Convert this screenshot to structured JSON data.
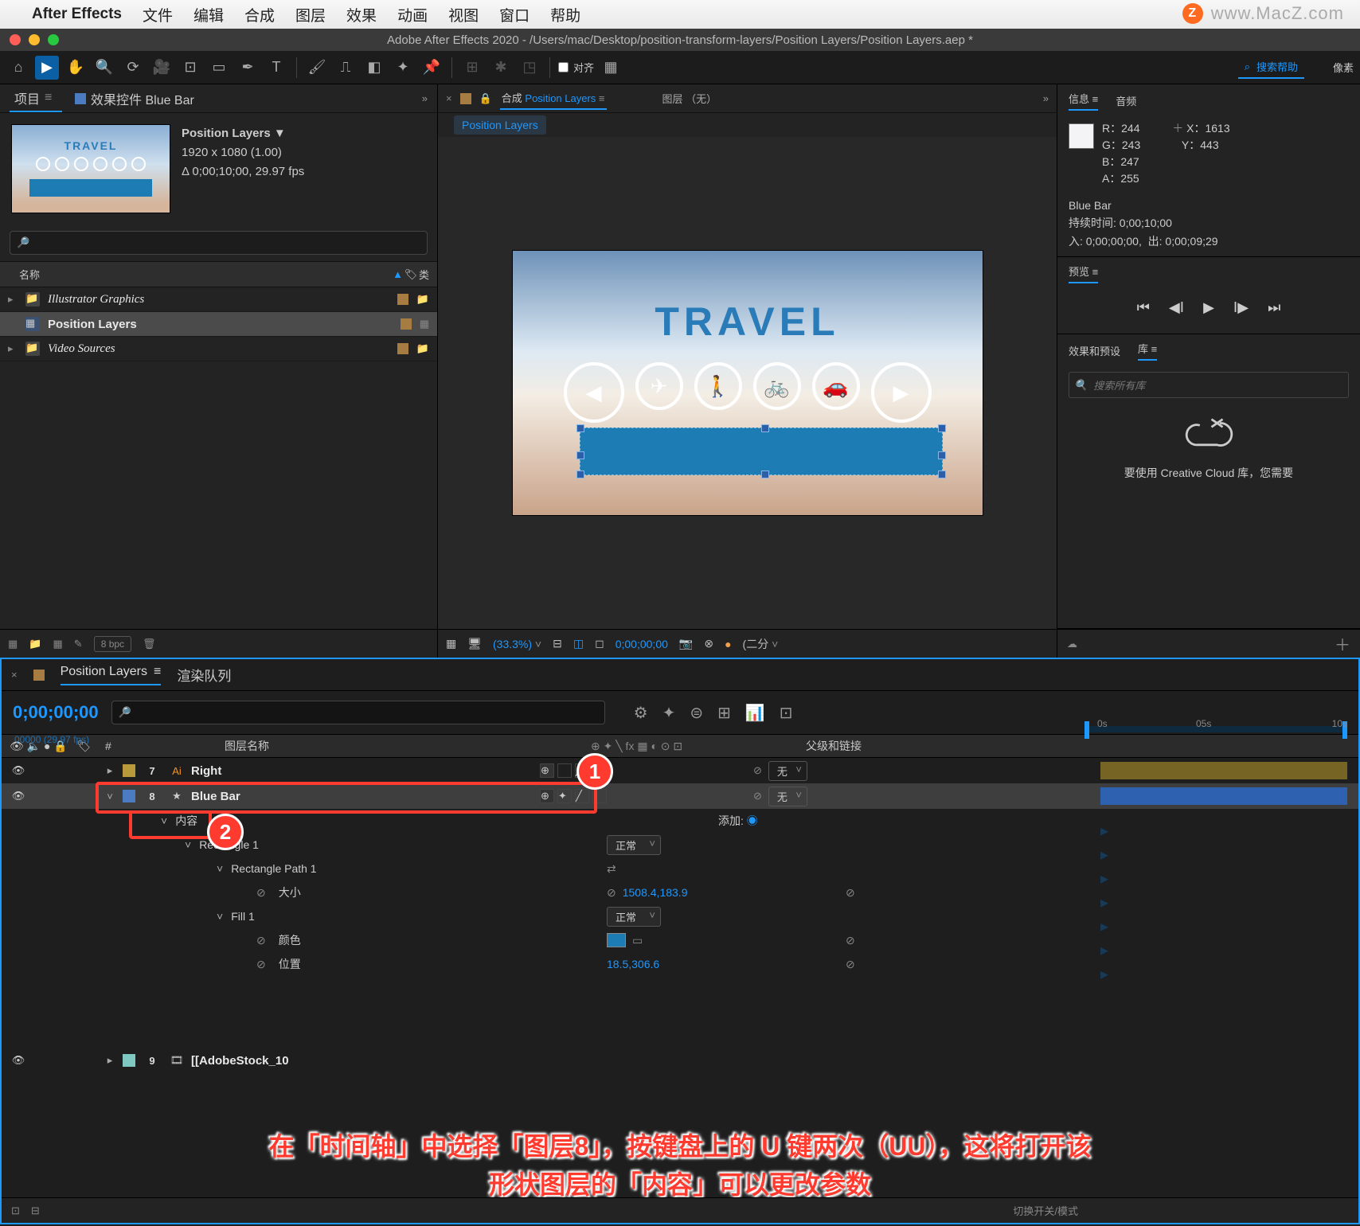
{
  "menubar": {
    "app": "After Effects",
    "items": [
      "文件",
      "编辑",
      "合成",
      "图层",
      "效果",
      "动画",
      "视图",
      "窗口",
      "帮助"
    ],
    "watermark": "www.MacZ.com"
  },
  "window": {
    "title": "Adobe After Effects 2020 - /Users/mac/Desktop/position-transform-layers/Position Layers/Position Layers.aep *"
  },
  "toolbar": {
    "snap": "对齐",
    "search_placeholder": "搜索帮助",
    "px": "像素"
  },
  "project": {
    "tab_project": "项目",
    "tab_effect": "效果控件 Blue Bar",
    "comp_name": "Position Layers",
    "comp_size": "1920 x 1080 (1.00)",
    "comp_dur": "Δ 0;00;10;00, 29.97 fps",
    "search_placeholder": "",
    "col_name": "名称",
    "col_type": "类",
    "items": [
      {
        "name": "Illustrator Graphics",
        "sel": false
      },
      {
        "name": "Position Layers",
        "sel": true
      },
      {
        "name": "Video Sources",
        "sel": false
      }
    ],
    "bpc": "8 bpc"
  },
  "comp": {
    "tab_label": "合成 Position Layers",
    "layer_tab": "图层 （无）",
    "flow": "Position Layers",
    "canvas_title": "TRAVEL",
    "foot_zoom": "(33.3%)",
    "foot_time": "0;00;00;00",
    "foot_half": "(二分"
  },
  "info": {
    "tab_info": "信息",
    "tab_audio": "音频",
    "R": "244",
    "G": "243",
    "B": "247",
    "A": "255",
    "X": "1613",
    "Y": "443",
    "layer": "Blue Bar",
    "dur_label": "持续时间:",
    "dur": "0;00;10;00",
    "in_label": "入:",
    "in": "0;00;00;00,",
    "out_label": "出:",
    "out": "0;00;09;29"
  },
  "preview": {
    "tab": "预览"
  },
  "effects": {
    "tab_fx": "效果和预设",
    "tab_lib": "库",
    "search": "搜索所有库",
    "cloud_msg": "要使用 Creative Cloud 库，您需要"
  },
  "timeline": {
    "tab": "Position Layers",
    "render": "渲染队列",
    "timecode": "0;00;00;00",
    "fps": "00000 (29.97 fps)",
    "ruler": {
      "a": "0s",
      "b": "05s",
      "c": "10s"
    },
    "head": {
      "num": "#",
      "name": "图层名称",
      "parent": "父级和链接"
    },
    "layer7": {
      "num": "7",
      "name": "Right",
      "parent": "无"
    },
    "layer8": {
      "num": "8",
      "name": "Blue Bar",
      "parent": "无"
    },
    "layer9": {
      "num": "9",
      "name": "[AdobeStock_10"
    },
    "contents": "内容",
    "add": "添加:",
    "rect1": "Rectangle 1",
    "mode_normal": "正常",
    "rectpath": "Rectangle Path 1",
    "size": "大小",
    "size_val": "1508.4,183.9",
    "fill": "Fill 1",
    "color": "颜色",
    "pos": "位置",
    "pos_val": "18.5,306.6",
    "switches": "切换开关/模式"
  },
  "caption": {
    "line1": "在「时间轴」中选择「图层8」，按键盘上的 U 键两次（UU），这将打开该",
    "line2": "形状图层的「内容」可以更改参数"
  },
  "badges": {
    "one": "1",
    "two": "2"
  }
}
